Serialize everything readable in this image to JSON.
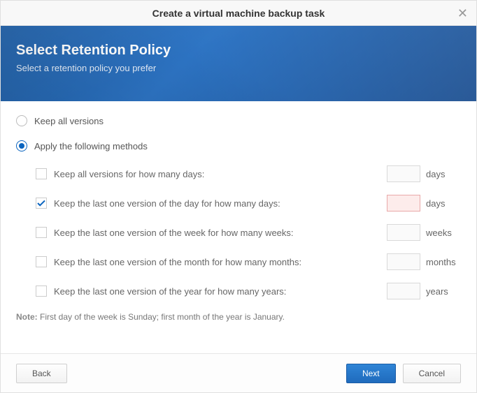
{
  "title": "Create a virtual machine backup task",
  "banner": {
    "heading": "Select Retention Policy",
    "subheading": "Select a retention policy you prefer"
  },
  "radio": {
    "keep_all": "Keep all versions",
    "apply_methods": "Apply the following methods",
    "selected": "apply_methods"
  },
  "options": [
    {
      "checked": false,
      "label": "Keep all versions for how many days:",
      "value": "",
      "unit": "days",
      "error": false
    },
    {
      "checked": true,
      "label": "Keep the last one version of the day for how many days:",
      "value": "",
      "unit": "days",
      "error": true
    },
    {
      "checked": false,
      "label": "Keep the last one version of the week for how many weeks:",
      "value": "",
      "unit": "weeks",
      "error": false
    },
    {
      "checked": false,
      "label": "Keep the last one version of the month for how many months:",
      "value": "",
      "unit": "months",
      "error": false
    },
    {
      "checked": false,
      "label": "Keep the last one version of the year for how many years:",
      "value": "",
      "unit": "years",
      "error": false
    }
  ],
  "note": {
    "prefix": "Note:",
    "text": "First day of the week is Sunday; first month of the year is January."
  },
  "buttons": {
    "back": "Back",
    "next": "Next",
    "cancel": "Cancel"
  }
}
